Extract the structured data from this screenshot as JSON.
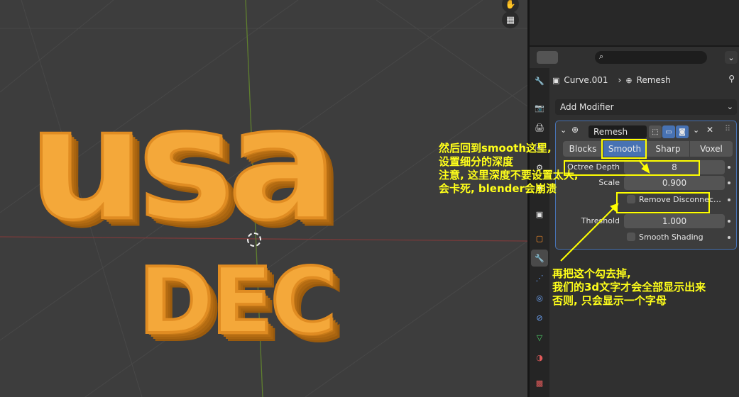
{
  "viewport": {
    "text_main": "usa",
    "text_sub": "DEC",
    "tools": [
      {
        "name": "hand-icon",
        "glyph": "✋"
      },
      {
        "name": "grid-icon",
        "glyph": "▦"
      }
    ]
  },
  "properties": {
    "breadcrumb": {
      "object": "Curve.001",
      "separator": "›",
      "modifier": "Remesh"
    },
    "add_modifier": "Add Modifier",
    "modifier": {
      "name": "Remesh",
      "modes": [
        "Blocks",
        "Smooth",
        "Sharp",
        "Voxel"
      ],
      "active_mode": "Smooth",
      "octree_depth_label": "Octree Depth",
      "octree_depth_value": "8",
      "scale_label": "Scale",
      "scale_value": "0.900",
      "remove_disconnected_label": "Remove Disconnec…",
      "remove_disconnected_checked": false,
      "threshold_label": "Threshold",
      "threshold_value": "1.000",
      "smooth_shading_label": "Smooth Shading",
      "smooth_shading_checked": false
    },
    "tabs": [
      {
        "name": "tool-tab",
        "glyph": "🔧"
      },
      {
        "name": "render-tab",
        "glyph": "📷"
      },
      {
        "name": "output-tab",
        "glyph": "🖨"
      },
      {
        "name": "view-layer-tab",
        "glyph": "🖼"
      },
      {
        "name": "scene-tab",
        "glyph": "⚙"
      },
      {
        "name": "world-tab",
        "glyph": "◉"
      },
      {
        "name": "collection-tab",
        "glyph": "▣"
      },
      {
        "name": "object-tab",
        "glyph": "▢"
      },
      {
        "name": "modifier-tab",
        "glyph": "🔧"
      },
      {
        "name": "particles-tab",
        "glyph": "⋰"
      },
      {
        "name": "physics-tab",
        "glyph": "◎"
      },
      {
        "name": "constraints-tab",
        "glyph": "⊘"
      },
      {
        "name": "data-tab",
        "glyph": "▽"
      },
      {
        "name": "material-tab",
        "glyph": "◑"
      },
      {
        "name": "texture-tab",
        "glyph": "▩"
      }
    ]
  },
  "annotations": {
    "top": [
      "然后回到smooth这里,",
      "设置细分的深度",
      "注意, 这里深度不要设置太大,",
      "会卡死, blender会崩溃"
    ],
    "bottom": [
      "再把这个勾去掉,",
      "我们的3d文字才会全部显示出来",
      "否则, 只会显示一个字母"
    ]
  },
  "colors": {
    "accent": "#4772b3",
    "text_orange": "#f4a83a",
    "annotation": "#ffff1a"
  }
}
